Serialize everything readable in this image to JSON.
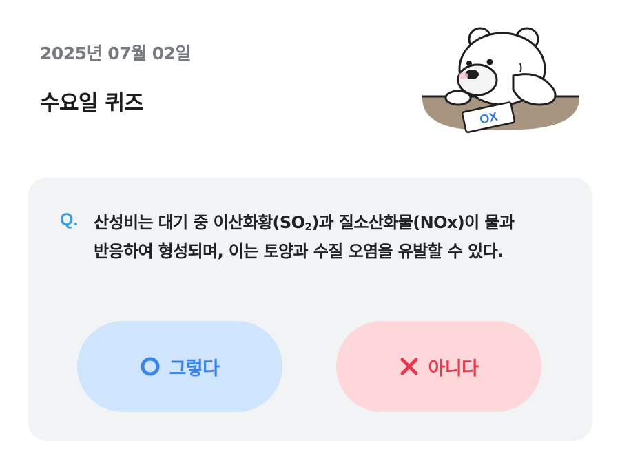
{
  "header": {
    "date": "2025년 07월 02일",
    "title": "수요일 퀴즈"
  },
  "quiz": {
    "q_mark": "Q.",
    "question_line1_pre": "산성비는 대기 중 이산화황(SO",
    "question_sub": "2",
    "question_line1_post": ")과 질소산화물(NOx)이 물과",
    "question_line2": "반응하여 형성되며, 이는 토양과 수질 오염을 유발할 수 있다.",
    "yes_label": "그렇다",
    "no_label": "아니다"
  },
  "mascot": {
    "card_text": "OX"
  },
  "colors": {
    "yes_bg": "#cfe5fd",
    "yes_fg": "#3a83ea",
    "no_bg": "#fdd7da",
    "no_fg": "#e7374a",
    "q_accent": "#3aa0dc",
    "card_bg": "#f2f3f5"
  },
  "icons": {
    "yes": "circle-o-icon",
    "no": "x-mark-icon"
  }
}
